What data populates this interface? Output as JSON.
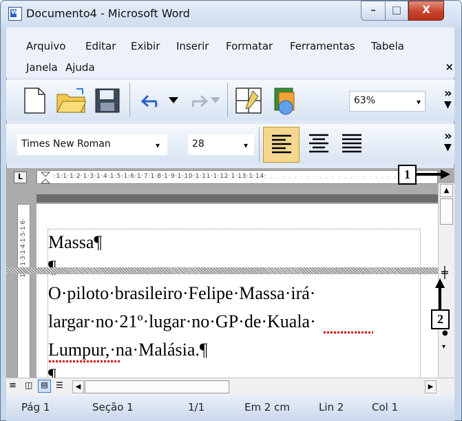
{
  "window": {
    "title": "Documento4 - Microsoft Word",
    "app_icon": "W"
  },
  "titlebar_buttons": {
    "minimize": "–",
    "maximize": "□",
    "close": "X"
  },
  "menu": [
    "Arquivo",
    "Editar",
    "Exibir",
    "Inserir",
    "Formatar",
    "Ferramentas",
    "Tabela",
    "Janela",
    "Ajuda"
  ],
  "menu_close": "×",
  "toolbar": {
    "zoom": "63%",
    "dropdown_arrow": "▾",
    "more": "»"
  },
  "format": {
    "font": "Times New Roman",
    "size": "28"
  },
  "document": {
    "lines": [
      "Massa¶",
      "¶",
      "O·piloto·brasileiro·Felipe·Massa·irá·",
      "largar·no·21º·lugar·no·GP·de·Kuala·",
      "Lumpur,·na·Malásia.¶",
      "¶"
    ]
  },
  "callouts": [
    "1",
    "2"
  ],
  "status": [
    "Pág 1",
    "Seção 1",
    "1/1",
    "Em 2 cm",
    "Lin 2",
    "Col 1"
  ],
  "colors": {
    "titlebar": "#cddcef",
    "close_button": "#c8442d",
    "active_toggle": "#f5d790"
  }
}
